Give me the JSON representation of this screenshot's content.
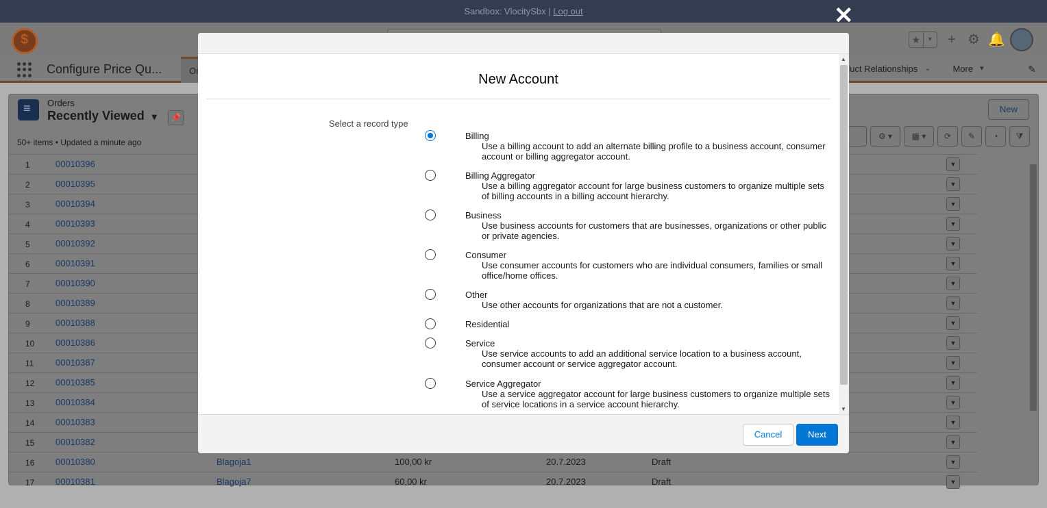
{
  "sandbox": {
    "text": "Sandbox: VlocitySbx |",
    "logout": "Log out"
  },
  "header": {
    "fav_star": "★",
    "fav_dropdown": "▾",
    "add": "+",
    "gear": "⚙",
    "bell": "🔔"
  },
  "nav": {
    "app_name": "Configure Price Qu...",
    "active_tab": "Or",
    "right_tab": "duct Relationships",
    "right_chevron": "⌄",
    "more": "More",
    "more_chevron": "▾",
    "edit": "✎"
  },
  "list": {
    "object_label": "Orders",
    "title": "Recently Viewed",
    "title_chevron": "▾",
    "pin": "📌",
    "meta": "50+ items • Updated a minute ago",
    "new_button": "New",
    "toolbar": {
      "settings": "⚙ ▾",
      "display": "▦ ▾",
      "refresh": "⟳",
      "edit": "✎",
      "chart": "◔",
      "filter": "⧩"
    },
    "rows": [
      {
        "num": "1",
        "order": "00010396",
        "account": "",
        "amount": "",
        "date": "",
        "status": ""
      },
      {
        "num": "2",
        "order": "00010395",
        "account": "",
        "amount": "",
        "date": "",
        "status": ""
      },
      {
        "num": "3",
        "order": "00010394",
        "account": "",
        "amount": "",
        "date": "",
        "status": ""
      },
      {
        "num": "4",
        "order": "00010393",
        "account": "",
        "amount": "",
        "date": "",
        "status": ""
      },
      {
        "num": "5",
        "order": "00010392",
        "account": "",
        "amount": "",
        "date": "",
        "status": ""
      },
      {
        "num": "6",
        "order": "00010391",
        "account": "",
        "amount": "",
        "date": "",
        "status": ""
      },
      {
        "num": "7",
        "order": "00010390",
        "account": "",
        "amount": "",
        "date": "",
        "status": ""
      },
      {
        "num": "8",
        "order": "00010389",
        "account": "",
        "amount": "",
        "date": "",
        "status": ""
      },
      {
        "num": "9",
        "order": "00010388",
        "account": "",
        "amount": "",
        "date": "",
        "status": ""
      },
      {
        "num": "10",
        "order": "00010386",
        "account": "",
        "amount": "",
        "date": "",
        "status": ""
      },
      {
        "num": "11",
        "order": "00010387",
        "account": "",
        "amount": "",
        "date": "",
        "status": ""
      },
      {
        "num": "12",
        "order": "00010385",
        "account": "",
        "amount": "",
        "date": "",
        "status": ""
      },
      {
        "num": "13",
        "order": "00010384",
        "account": "",
        "amount": "",
        "date": "",
        "status": ""
      },
      {
        "num": "14",
        "order": "00010383",
        "account": "",
        "amount": "",
        "date": "",
        "status": ""
      },
      {
        "num": "15",
        "order": "00010382",
        "account": "",
        "amount": "",
        "date": "",
        "status": ""
      },
      {
        "num": "16",
        "order": "00010380",
        "account": "Blagoja1",
        "amount": "100,00 kr",
        "date": "20.7.2023",
        "status": "Draft"
      },
      {
        "num": "17",
        "order": "00010381",
        "account": "Blagoja7",
        "amount": "60,00 kr",
        "date": "20.7.2023",
        "status": "Draft"
      }
    ]
  },
  "close_glyph": "✕",
  "modal": {
    "title": "New Account",
    "record_type_label": "Select a record type",
    "options": [
      {
        "label": "Billing",
        "description": "Use a billing account to add an alternate billing profile to a business account, consumer account or billing aggregator account.",
        "selected": true
      },
      {
        "label": "Billing Aggregator",
        "description": "Use a billing aggregator account for large business customers to organize multiple sets of billing accounts in a billing account hierarchy.",
        "selected": false
      },
      {
        "label": "Business",
        "description": "Use business accounts for customers that are businesses, organizations or other public or private agencies.",
        "selected": false
      },
      {
        "label": "Consumer",
        "description": "Use consumer accounts for customers who are individual consumers, families or small office/home offices.",
        "selected": false
      },
      {
        "label": "Other",
        "description": "Use other accounts for organizations that are not a customer.",
        "selected": false
      },
      {
        "label": "Residential",
        "description": "",
        "selected": false
      },
      {
        "label": "Service",
        "description": "Use service accounts to add an additional service location to a business account, consumer account or service aggregator account.",
        "selected": false
      },
      {
        "label": "Service Aggregator",
        "description": "Use a service aggregator account for large business customers to organize multiple sets of service locations in a service account hierarchy.",
        "selected": false
      }
    ],
    "cancel": "Cancel",
    "next": "Next"
  },
  "colors": {
    "brand_blue": "#0176d3",
    "overlay_header": "#343c52",
    "close_icon": "#ffffff"
  }
}
